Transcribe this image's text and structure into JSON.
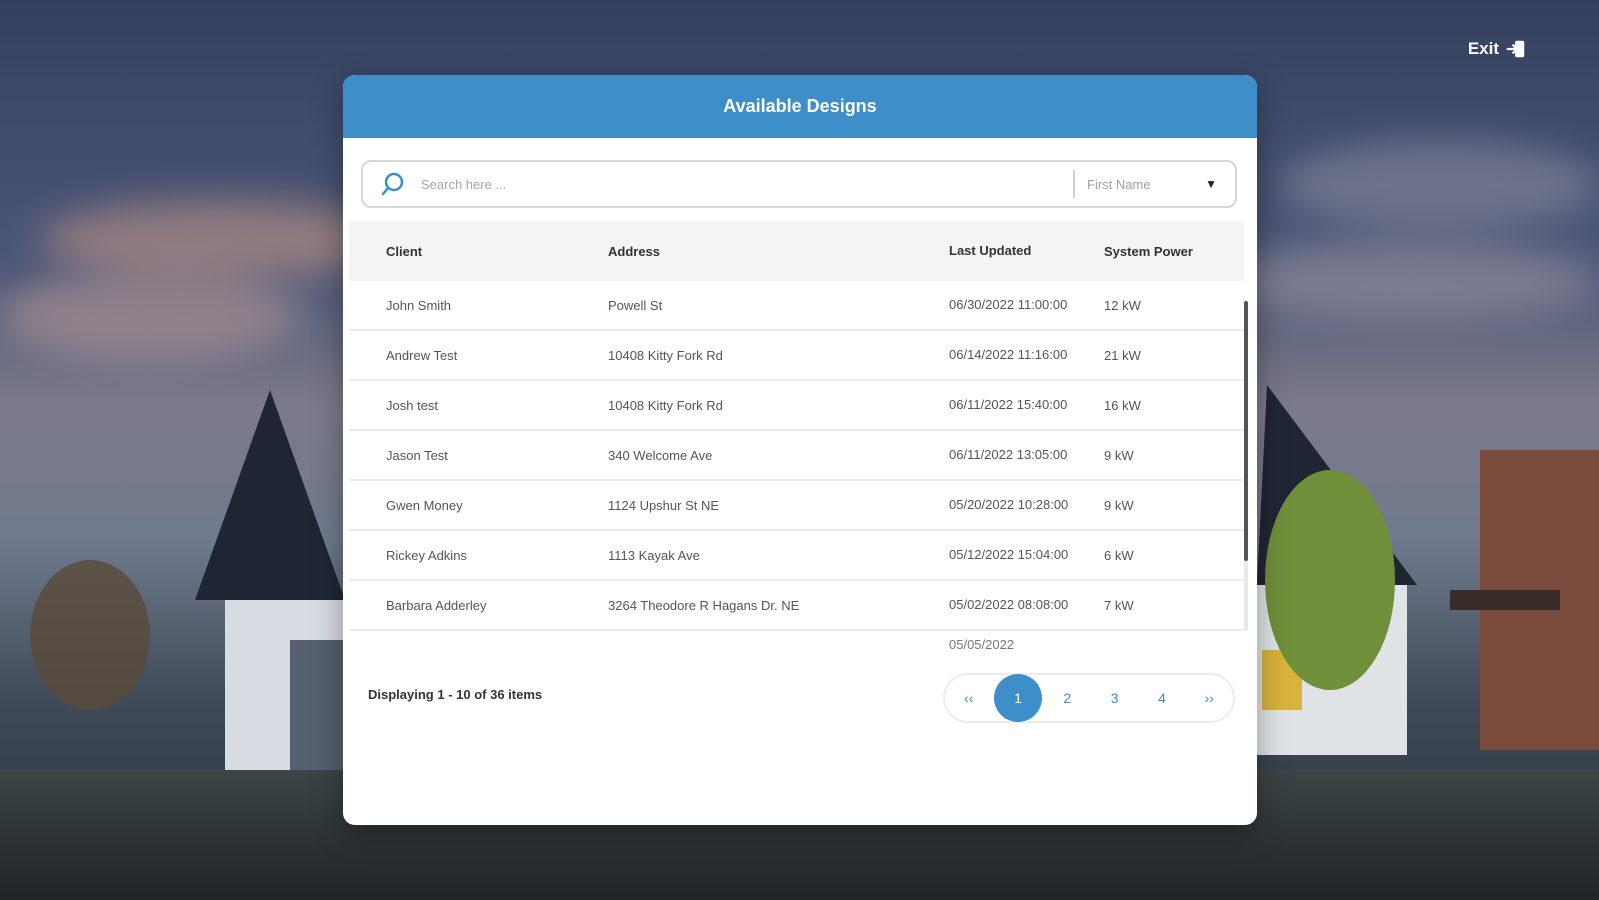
{
  "header": {
    "exit_label": "Exit"
  },
  "modal": {
    "title": "Available Designs",
    "search": {
      "placeholder": "Search here ...",
      "filter_value": "First Name"
    },
    "table": {
      "columns": [
        "Client",
        "Address",
        "Last Updated",
        "System Power"
      ],
      "rows": [
        {
          "client": "John Smith",
          "address": "Powell St",
          "updated": "06/30/2022 11:00:00",
          "power": "12 kW"
        },
        {
          "client": "Andrew Test",
          "address": "10408 Kitty Fork Rd",
          "updated": "06/14/2022 11:16:00",
          "power": "21 kW"
        },
        {
          "client": "Josh test",
          "address": "10408 Kitty Fork Rd",
          "updated": "06/11/2022 15:40:00",
          "power": "16 kW"
        },
        {
          "client": "Jason Test",
          "address": "340 Welcome Ave",
          "updated": "06/11/2022 13:05:00",
          "power": "9 kW"
        },
        {
          "client": "Gwen Money",
          "address": "1124 Upshur St NE",
          "updated": "05/20/2022 10:28:00",
          "power": "9 kW"
        },
        {
          "client": "Rickey Adkins",
          "address": "1113 Kayak Ave",
          "updated": "05/12/2022 15:04:00",
          "power": "6 kW"
        },
        {
          "client": "Barbara Adderley",
          "address": "3264 Theodore R Hagans Dr. NE",
          "updated": "05/02/2022 08:08:00",
          "power": "7 kW"
        }
      ],
      "partial_row": {
        "updated": "05/05/2022"
      }
    },
    "footer": {
      "summary": "Displaying 1 - 10 of 36 items"
    },
    "pagination": {
      "first": "‹‹",
      "pages": [
        "1",
        "2",
        "3",
        "4"
      ],
      "last": "››",
      "active": "1"
    }
  },
  "colors": {
    "accent": "#3d8ec9"
  }
}
